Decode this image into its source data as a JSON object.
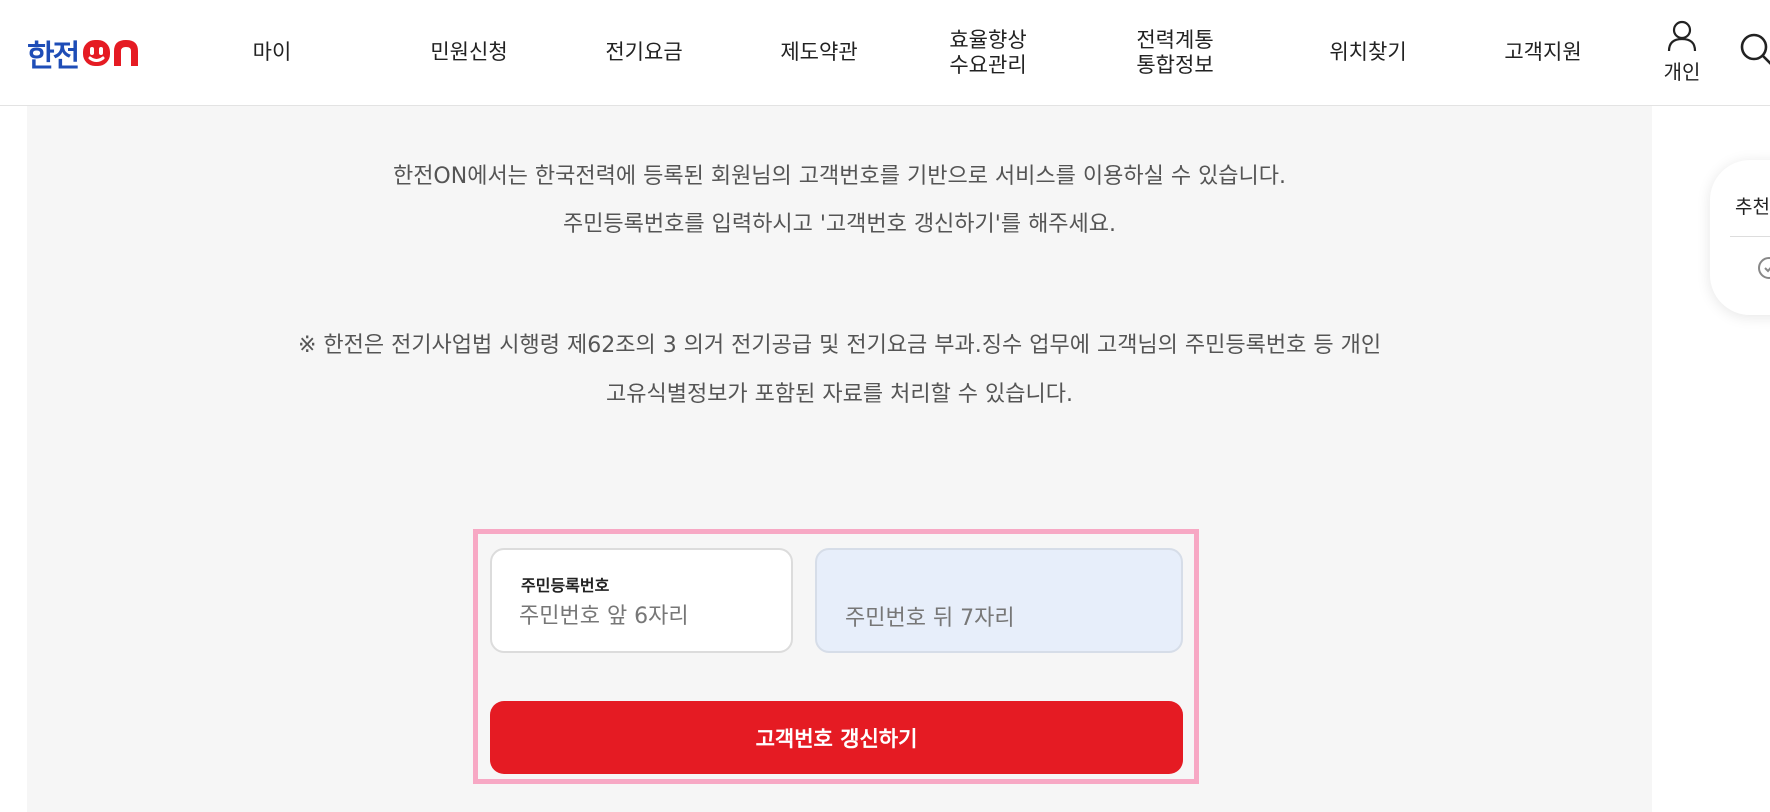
{
  "header": {
    "logo_text": "한전ON",
    "nav": [
      "마이",
      "민원신청",
      "전기요금",
      "제도약관",
      "효율향상\n수요관리",
      "전력계통\n통합정보",
      "위치찾기",
      "고객지원"
    ],
    "user_label": "개인",
    "user_icon": "person-icon",
    "search_icon": "search-icon"
  },
  "intro": {
    "line1": "한전ON에서는 한국전력에 등록된 회원님의 고객번호를 기반으로 서비스를 이용하실 수 있습니다.",
    "line2": "주민등록번호를 입력하시고 '고객번호 갱신하기'를 해주세요."
  },
  "notice": {
    "line1": "※ 한전은 전기사업법 시행령 제62조의 3 의거 전기공급 및 전기요금 부과.징수 업무에 고객님의 주민등록번호 등 개인",
    "line2": "고유식별정보가 포함된 자료를 처리할 수 있습니다."
  },
  "form": {
    "field_label": "주민등록번호",
    "front_value": "",
    "front_placeholder": "주민번호 앞 6자리",
    "back_value": "",
    "back_placeholder": "주민번호 뒤 7자리",
    "submit_label": "고객번호 갱신하기"
  },
  "side_panel": {
    "title": "추천",
    "icon": "circle-icon"
  },
  "colors": {
    "brand_blue": "#1e4db7",
    "brand_red": "#e51b23",
    "highlight_border": "#f7a8c4",
    "back_field_bg": "#e7eefa"
  }
}
